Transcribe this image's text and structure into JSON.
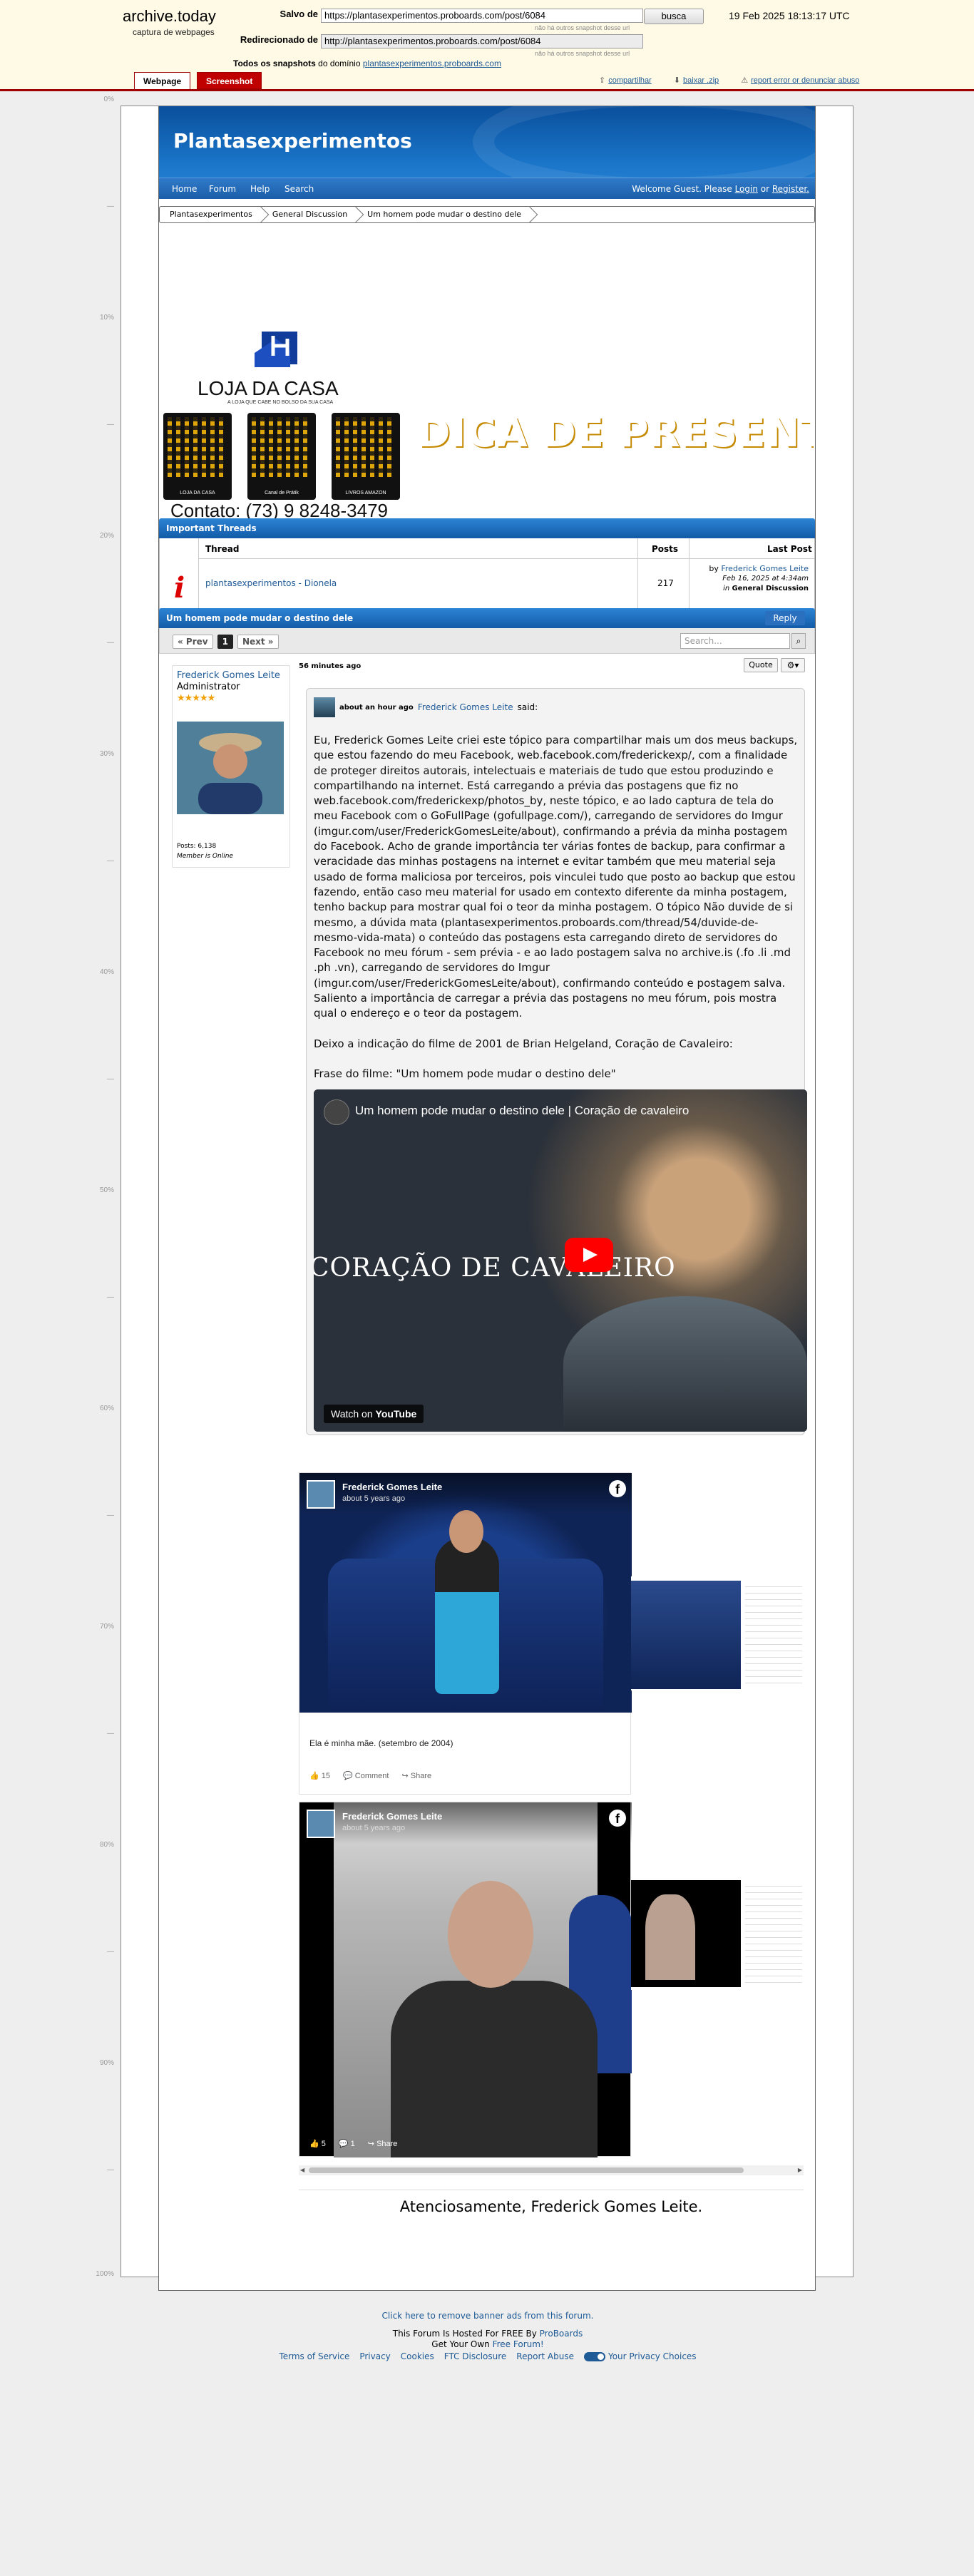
{
  "archive": {
    "logo": "archive.today",
    "tagline": "captura de webpages",
    "saved_label": "Salvo de",
    "saved_url": "https://plantasexperimentos.proboards.com/post/6084",
    "search_button": "busca",
    "no_other_note_1": "não há outros snapshot desse url",
    "redirect_label": "Redirecionado de",
    "redirect_url": "http://plantasexperimentos.proboards.com/post/6084",
    "no_other_note_2": "não há outros snapshot desse url",
    "date": "19 Feb 2025 18:13:17 UTC",
    "all_snapshots_label": "Todos os snapshots",
    "all_snapshots_from": "do domínio",
    "domain_link": "plantasexperimentos.proboards.com",
    "tab_webpage": "Webpage",
    "tab_screenshot": "Screenshot",
    "link_share": "compartilhar",
    "link_download": "baixar .zip",
    "link_report": "report error or denunciar abuso"
  },
  "ruler": [
    "0%",
    "10%",
    "20%",
    "30%",
    "40%",
    "50%",
    "60%",
    "70%",
    "80%",
    "90%",
    "100%"
  ],
  "forum": {
    "title": "Plantasexperimentos",
    "nav": [
      "Home",
      "Forum",
      "Help",
      "Search"
    ],
    "welcome_text": "Welcome Guest. Please",
    "login": "Login",
    "or": "or",
    "register": "Register."
  },
  "breadcrumb": [
    "Plantasexperimentos",
    "General Discussion",
    "Um homem pode mudar o destino dele"
  ],
  "banner": {
    "store_name": "LOJA DA CASA",
    "store_sub": "A LOJA QUE CABE NO BOLSO DA SUA CASA",
    "headline": "DICA DE PRESENTE",
    "instagram": "https://www.instagram.com/lo",
    "contact": "Contato: (73) 9 8248-3479",
    "qr_captions": [
      "LOJA DA CASA",
      "Canal de Prátik",
      "LIVROS AMAZON"
    ]
  },
  "important": {
    "header": "Important Threads",
    "col_thread": "Thread",
    "col_posts": "Posts",
    "col_last": "Last Post",
    "thread_title": "plantasexperimentos - Dionela",
    "posts": "217",
    "last_by": "by",
    "last_author": "Frederick Gomes Leite",
    "last_date": "Feb 16, 2025 at 4:34am",
    "last_in": "in",
    "last_board": "General Discussion"
  },
  "thread": {
    "title": "Um homem pode mudar o destino dele",
    "reply_button": "Reply",
    "prev": "« Prev",
    "page": "1",
    "next": "Next »",
    "search_placeholder": "Search...",
    "search_icon": "magnifier-icon"
  },
  "user": {
    "name": "Frederick Gomes Leite",
    "role": "Administrator",
    "stars": "★★★★★",
    "posts": "Posts: 6,138",
    "member_status": "Member is Online"
  },
  "post": {
    "time": "56 minutes ago",
    "quote_button": "Quote",
    "quote_time": "about an hour ago",
    "quote_author": "Frederick Gomes Leite",
    "quote_said": "said:",
    "p1": "Eu, Frederick Gomes Leite criei este tópico para compartilhar mais um dos meus backups, que estou fazendo do meu Facebook, web.facebook.com/frederickexp/, com a finalidade de proteger direitos autorais, intelectuais e materiais de tudo que estou produzindo e compartilhando na internet. Está carregando a prévia das postagens que fiz no web.facebook.com/frederickexp/photos_by, neste tópico, e ao lado captura de tela do meu Facebook com o GoFullPage (gofullpage.com/), carregando de servidores do Imgur (imgur.com/user/FrederickGomesLeite/about), confirmando a prévia da minha postagem do Facebook. Acho de grande importância ter várias fontes de backup, para confirmar a veracidade das minhas postagens na internet e evitar também que meu material seja usado de forma maliciosa por terceiros, pois vinculei tudo que posto ao backup que estou fazendo, então caso meu material for usado em contexto diferente da minha postagem, tenho backup para mostrar qual foi o teor da minha postagem. O tópico Não duvide de si mesmo, a dúvida mata (plantasexperimentos.proboards.com/thread/54/duvide-de-mesmo-vida-mata) o conteúdo das postagens esta carregando direto de servidores do Facebook no meu fórum - sem prévia - e ao lado postagem salva no archive.is (.fo .li .md .ph .vn), carregando de servidores do Imgur (imgur.com/user/FrederickGomesLeite/about), confirmando conteúdo e postagem salva. Saliento a importância de carregar a prévia das postagens no meu fórum, pois mostra qual o endereço e o teor da postagem.",
    "p2": "Deixo a indicação do filme de 2001 de Brian Helgeland, Coração de Cavaleiro:",
    "p3": "Frase do filme: \"Um homem pode mudar o destino dele\"",
    "video_title": "Um homem pode mudar o destino dele | Coração de cavaleiro",
    "video_caption": "CORAÇÃO DE CAVALEIRO",
    "watch_on": "Watch on",
    "youtube": "YouTube",
    "signature": "Atenciosamente, Frederick Gomes Leite."
  },
  "fb_posts": [
    {
      "author": "Frederick Gomes Leite",
      "time": "about 5 years ago",
      "caption": "Ela é minha mãe. (setembro de 2004)",
      "likes": "15",
      "comment": "Comment",
      "share": "Share"
    },
    {
      "author": "Frederick Gomes Leite",
      "time": "about 5 years ago",
      "likes": "5",
      "comments": "1",
      "share": "Share"
    }
  ],
  "footer": {
    "remove_ads": "Click here to remove banner ads from this forum.",
    "hosted": "This Forum Is Hosted For FREE By",
    "proboards": "ProBoards",
    "own": "Get Your Own",
    "free_forum": "Free Forum!",
    "links": [
      "Terms of Service",
      "Privacy",
      "Cookies",
      "FTC Disclosure",
      "Report Abuse"
    ],
    "privacy_choices": "Your Privacy Choices"
  }
}
